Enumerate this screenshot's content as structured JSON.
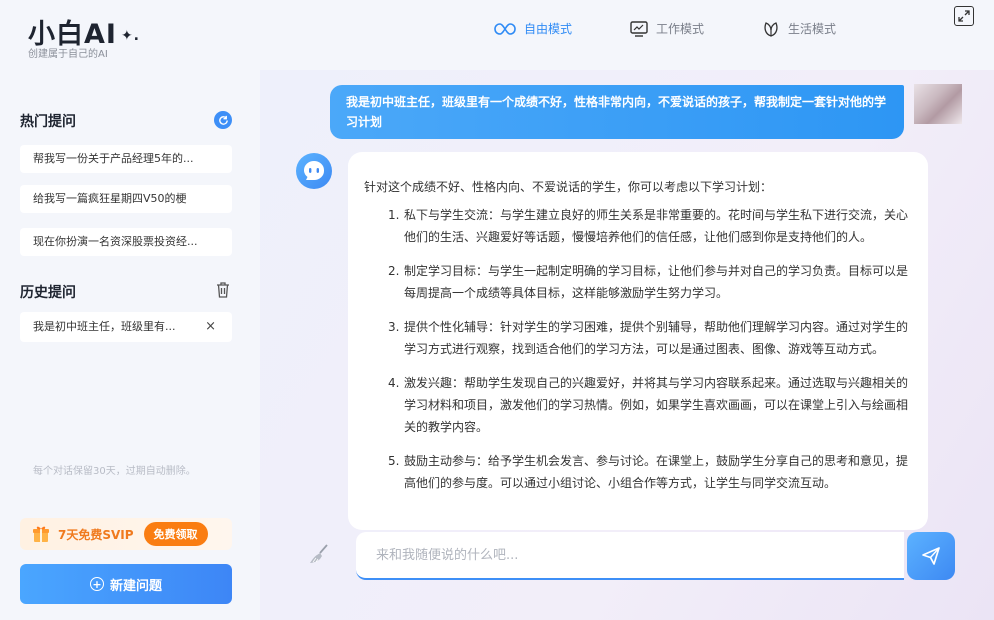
{
  "header": {
    "logo_title": "小白AI",
    "logo_spark": "✦.",
    "logo_subtitle": "创建属于自己的AI",
    "modes": [
      {
        "label": "自由模式",
        "icon": "infinity-icon",
        "active": true
      },
      {
        "label": "工作模式",
        "icon": "monitor-icon",
        "active": false
      },
      {
        "label": "生活模式",
        "icon": "leaf-icon",
        "active": false
      }
    ]
  },
  "sidebar": {
    "hot_title": "热门提问",
    "hot_items": [
      "帮我写一份关于产品经理5年的...",
      "给我写一篇疯狂星期四V50的梗",
      "现在你扮演一名资深股票投资经..."
    ],
    "history_title": "历史提问",
    "history_items": [
      {
        "label": "我是初中班主任，班级里有...",
        "close": "×"
      }
    ],
    "retain_note": "每个对话保留30天，过期自动删除。",
    "svip_text": "7天免费SVIP",
    "svip_button": "免费领取",
    "new_button": "新建问题"
  },
  "chat": {
    "user_message": "我是初中班主任，班级里有一个成绩不好，性格非常内向，不爱说话的孩子，帮我制定一套针对他的学习计划",
    "ai_intro": "针对这个成绩不好、性格内向、不爱说话的学生，你可以考虑以下学习计划：",
    "ai_points": [
      {
        "num": "1.",
        "text": "私下与学生交流：与学生建立良好的师生关系是非常重要的。花时间与学生私下进行交流，关心他们的生活、兴趣爱好等话题，慢慢培养他们的信任感，让他们感到你是支持他们的人。"
      },
      {
        "num": "2.",
        "text": "制定学习目标：与学生一起制定明确的学习目标，让他们参与并对自己的学习负责。目标可以是每周提高一个成绩等具体目标，这样能够激励学生努力学习。"
      },
      {
        "num": "3.",
        "text": "提供个性化辅导：针对学生的学习困难，提供个别辅导，帮助他们理解学习内容。通过对学生的学习方式进行观察，找到适合他们的学习方法，可以是通过图表、图像、游戏等互动方式。"
      },
      {
        "num": "4.",
        "text": "激发兴趣：帮助学生发现自己的兴趣爱好，并将其与学习内容联系起来。通过选取与兴趣相关的学习材料和项目，激发他们的学习热情。例如，如果学生喜欢画画，可以在课堂上引入与绘画相关的教学内容。"
      },
      {
        "num": "5.",
        "text": "鼓励主动参与：给予学生机会发言、参与讨论。在课堂上，鼓励学生分享自己的思考和意见，提高他们的参与度。可以通过小组讨论、小组合作等方式，让学生与同学交流互动。"
      }
    ],
    "input_placeholder": "来和我随便说的什么吧...",
    "input_value": ""
  },
  "colors": {
    "accent": "#3d8ff7",
    "svip_orange": "#fa7d12"
  }
}
